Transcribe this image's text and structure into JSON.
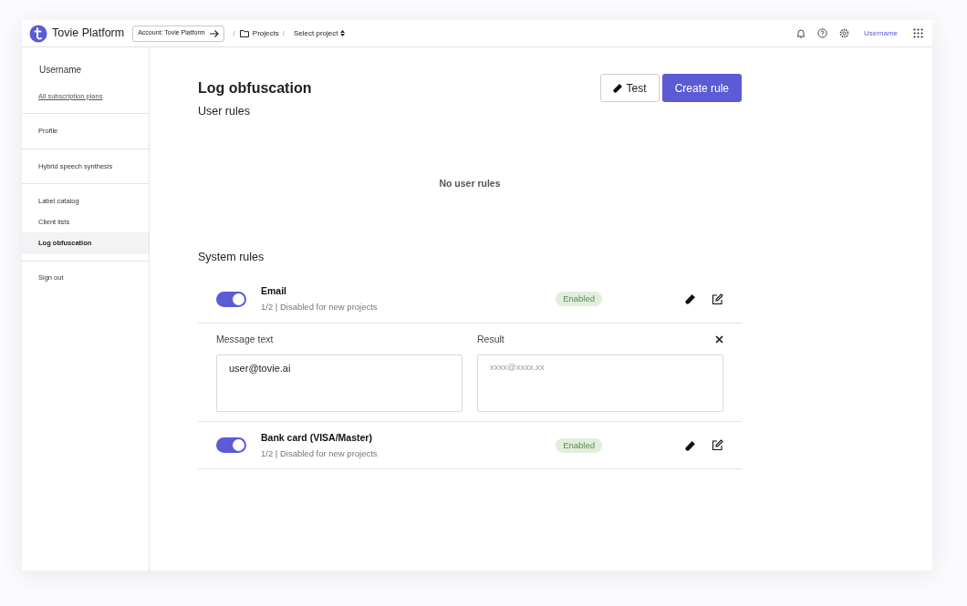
{
  "header": {
    "logo_text": "Tovie Platform",
    "account_button": "Account: Tovie Platform",
    "separator_1": "/",
    "breadcrumb": "Projects",
    "separator_2": "/",
    "project_select": "Select project",
    "username": "Username"
  },
  "sidebar": {
    "username": "Username",
    "plans_link": "All subscription plans",
    "groups": [
      [
        {
          "label": "Profile",
          "selected": false
        }
      ],
      [
        {
          "label": "Hybrid speech synthesis",
          "selected": false
        }
      ],
      [
        {
          "label": "Label catalog",
          "selected": false
        },
        {
          "label": "Client lists",
          "selected": false
        },
        {
          "label": "Log obfuscation",
          "selected": true
        }
      ],
      [
        {
          "label": "Sign out",
          "selected": false
        }
      ]
    ]
  },
  "main": {
    "title": "Log obfuscation",
    "test_button": "Test",
    "create_button": "Create rule",
    "user_rules_heading": "User rules",
    "user_rules_empty": "No user rules",
    "system_rules_heading": "System rules",
    "rules": [
      {
        "name": "Email",
        "description": "1/2 | Disabled for new projects",
        "on": true,
        "status": "Enabled",
        "test": {
          "message_label": "Message text",
          "message_value": "user@tovie.ai",
          "result_label": "Result",
          "result_placeholder": "xxxx@xxxx.xx"
        }
      },
      {
        "name": "Bank card (VISA/Master)",
        "description": "1/2 | Disabled for new projects",
        "on": true,
        "status": "Enabled"
      }
    ]
  }
}
